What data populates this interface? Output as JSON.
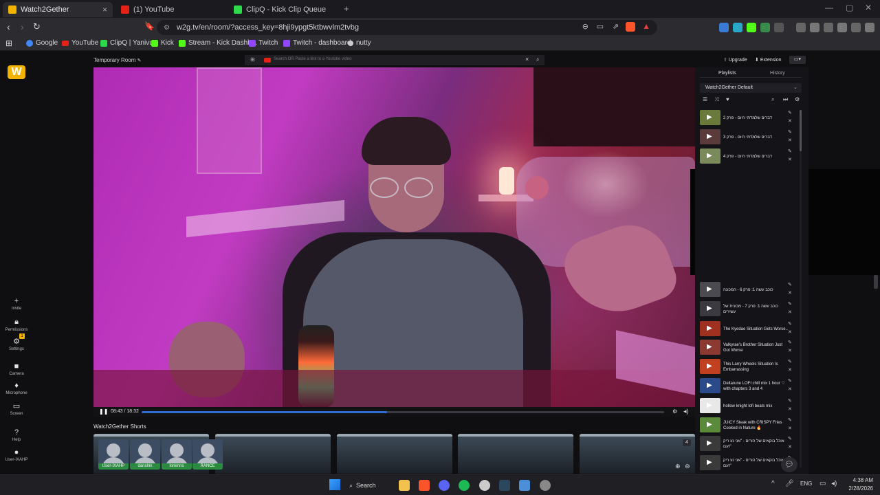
{
  "browser": {
    "tabs": [
      {
        "label": "Watch2Gether",
        "active": true,
        "favicon_color": "#f2b400"
      },
      {
        "label": "(1) YouTube",
        "active": false,
        "favicon_color": "#e62117"
      },
      {
        "label": "ClipQ - Kick Clip Queue",
        "active": false,
        "favicon_color": "#2bd94a"
      }
    ],
    "new_tab": "+",
    "url": "w2g.tv/en/room/?access_key=8hji9ypgt5ktbwvlm2tvbg",
    "bookmarks": [
      {
        "label": "Google",
        "icon": "google-icon",
        "color": "#4285f4"
      },
      {
        "label": "YouTube",
        "icon": "youtube-icon",
        "color": "#e62117"
      },
      {
        "label": "ClipQ | Yanivu",
        "icon": "clipq-icon",
        "color": "#2bd94a"
      },
      {
        "label": "Kick",
        "icon": "kick-icon",
        "color": "#53fc18"
      },
      {
        "label": "Stream - Kick Dashb...",
        "icon": "kick-icon",
        "color": "#53fc18"
      },
      {
        "label": "Twitch",
        "icon": "twitch-icon",
        "color": "#9146ff"
      },
      {
        "label": "Twitch - dashboard",
        "icon": "twitch-icon",
        "color": "#9146ff"
      },
      {
        "label": "nutty",
        "icon": "nutty-icon",
        "color": "#cccccc"
      }
    ]
  },
  "room": {
    "title": "Temporary Room",
    "search_placeholder": "Search OR Paste a link to a Youtube video",
    "upgrade_label": "Upgrade",
    "extension_label": "Extension",
    "time_display": "08:43 / 18:32",
    "progress_fraction": 0.47,
    "shorts_title": "Watch2Gether Shorts"
  },
  "left_rail": [
    {
      "label": "Invite",
      "glyph": "👤"
    },
    {
      "label": "Permissions",
      "glyph": "🔒"
    },
    {
      "label": "Settings",
      "glyph": "⚙",
      "badge": "1"
    },
    {
      "label": "Camera",
      "glyph": "📷"
    },
    {
      "label": "Microphone",
      "glyph": "🎤"
    },
    {
      "label": "Screen",
      "glyph": "🖥"
    },
    {
      "label": "Help",
      "glyph": "?"
    },
    {
      "label": "User-IXAHP",
      "glyph": "👤"
    }
  ],
  "panel": {
    "tabs": [
      "Playlists",
      "History"
    ],
    "playlist_name": "Watch2Gether Default",
    "items": [
      {
        "title": "דברים שלמדתי היום - פרק 2",
        "color": "#6a7a3a"
      },
      {
        "title": "דברים שלמדתי היום - פרק 3",
        "color": "#5a3a3a"
      },
      {
        "title": "דברים שלמדתי היום - פרק 4",
        "color": "#7a8a5a"
      },
      {
        "title": "כוכב עשה 1: פרק 6 - המכונה",
        "color": "#4a4a50"
      },
      {
        "title": "כוכב עשה 1: פרק 7 - מכונית של עשירים",
        "color": "#3a3a40"
      },
      {
        "title": "The Kyedae Situation Gets Worse..",
        "color": "#a03020"
      },
      {
        "title": "Valkyrae's Brother Situation Just Got Worse",
        "color": "#8a3a30"
      },
      {
        "title": "This Larry Wheels Situation Is Embarrassing",
        "color": "#c04020"
      },
      {
        "title": "Deltarune LOFI chill mix 1 hour ♡ with chapters 3 and 4",
        "color": "#2a4a8a"
      },
      {
        "title": "hollow knight lofi beats mix",
        "color": "#e8e8e8"
      },
      {
        "title": "JUICY Steak with CRISPY Fries Cooked in Nature 🔥",
        "color": "#5a8a3a"
      },
      {
        "title": "אוכל בוקאים של הורים - \"אני נע ריק זעם\"",
        "color": "#3a3a3a"
      },
      {
        "title": "אוכל בוקאים של הורים - \"אני נע ריק זעם\"",
        "color": "#3a3a3a"
      }
    ]
  },
  "participants": [
    {
      "name": "User-IXAHP"
    },
    {
      "name": "danshin"
    },
    {
      "name": "lommns"
    },
    {
      "name": "RANCE"
    }
  ],
  "shorts_count_badge": "4",
  "taskbar": {
    "search_label": "Search",
    "language": "ENG",
    "time": "4:38 AM",
    "date": "2/28/2026",
    "apps": [
      {
        "name": "file-explorer-icon",
        "color": "#f2c14e"
      },
      {
        "name": "brave-icon",
        "color": "#fb542b"
      },
      {
        "name": "discord-icon",
        "color": "#5865f2"
      },
      {
        "name": "spotify-icon",
        "color": "#1db954"
      },
      {
        "name": "chatgpt-icon",
        "color": "#cccccc"
      },
      {
        "name": "steam-icon",
        "color": "#2a475e"
      },
      {
        "name": "app-icon",
        "color": "#4a8fd8"
      },
      {
        "name": "app-icon-2",
        "color": "#888888"
      }
    ]
  }
}
